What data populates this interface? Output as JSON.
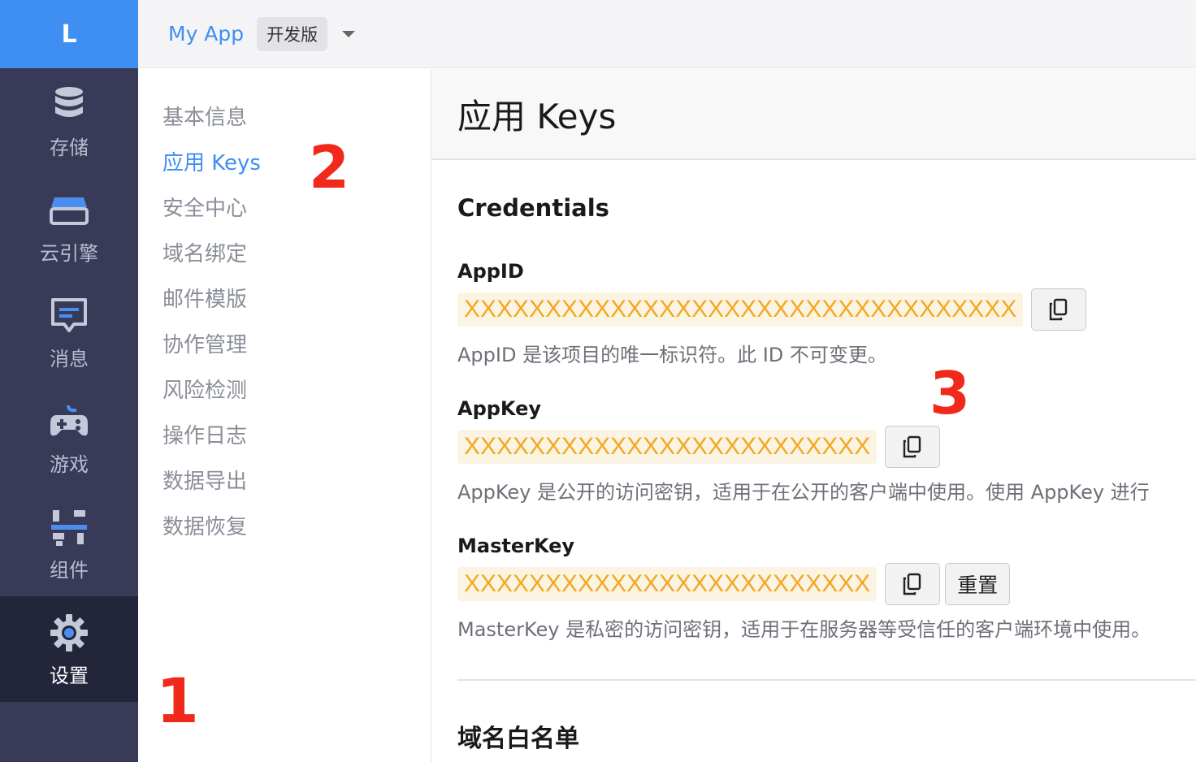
{
  "rail": {
    "logo": "L",
    "items": [
      {
        "label": "存储",
        "icon": "database-icon"
      },
      {
        "label": "云引擎",
        "icon": "server-icon"
      },
      {
        "label": "消息",
        "icon": "message-icon"
      },
      {
        "label": "游戏",
        "icon": "gamepad-icon"
      },
      {
        "label": "组件",
        "icon": "components-icon"
      },
      {
        "label": "设置",
        "icon": "gear-icon",
        "active": true
      }
    ]
  },
  "topbar": {
    "app_name": "My App",
    "env": "开发版"
  },
  "subnav": {
    "items": [
      "基本信息",
      "应用 Keys",
      "安全中心",
      "域名绑定",
      "邮件模版",
      "协作管理",
      "风险检测",
      "操作日志",
      "数据导出",
      "数据恢复"
    ],
    "active_index": 1
  },
  "annotations": [
    "1",
    "2",
    "3"
  ],
  "content": {
    "title": "应用 Keys",
    "section": "Credentials",
    "fields": [
      {
        "label": "AppID",
        "value": "XXXXXXXXXXXXXXXXXXXXXXXXXXXXXXXXXX",
        "desc": "AppID 是该项目的唯一标识符。此 ID 不可变更。"
      },
      {
        "label": "AppKey",
        "value": "XXXXXXXXXXXXXXXXXXXXXXXXX",
        "desc": "AppKey 是公开的访问密钥，适用于在公开的客户端中使用。使用 AppKey 进行"
      },
      {
        "label": "MasterKey",
        "value": "XXXXXXXXXXXXXXXXXXXXXXXXX",
        "desc": "MasterKey 是私密的访问密钥，适用于在服务器等受信任的客户端环境中使用。",
        "reset_label": "重置"
      }
    ],
    "section2": "域名白名单"
  },
  "colors": {
    "accent": "#3f8ef2",
    "rail_bg": "#383a58",
    "rail_active_bg": "#23253b",
    "key_text": "#f5a623",
    "key_bg": "#fcf4e2",
    "annotation": "#f0291b"
  }
}
